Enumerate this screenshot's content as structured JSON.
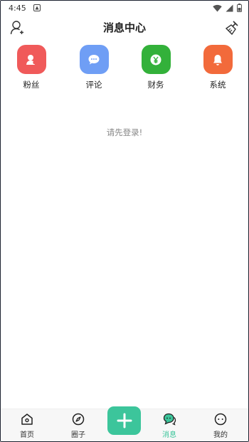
{
  "status": {
    "time": "4:45"
  },
  "header": {
    "title": "消息中心"
  },
  "categories": [
    {
      "label": "粉丝",
      "icon": "fans-icon",
      "color": "#f05a5a"
    },
    {
      "label": "评论",
      "icon": "comment-icon",
      "color": "#6f9ef5"
    },
    {
      "label": "财务",
      "icon": "finance-icon",
      "color": "#33b13a"
    },
    {
      "label": "系统",
      "icon": "bell-icon",
      "color": "#f26a3b"
    }
  ],
  "content": {
    "login_tip": "请先登录!"
  },
  "tabbar": {
    "accent": "#3cc59b",
    "tabs": [
      {
        "label": "首页",
        "icon": "home-icon"
      },
      {
        "label": "圈子",
        "icon": "compass-icon"
      },
      {
        "label": "消息",
        "icon": "message-icon",
        "active": true
      },
      {
        "label": "我的",
        "icon": "profile-icon"
      }
    ]
  }
}
